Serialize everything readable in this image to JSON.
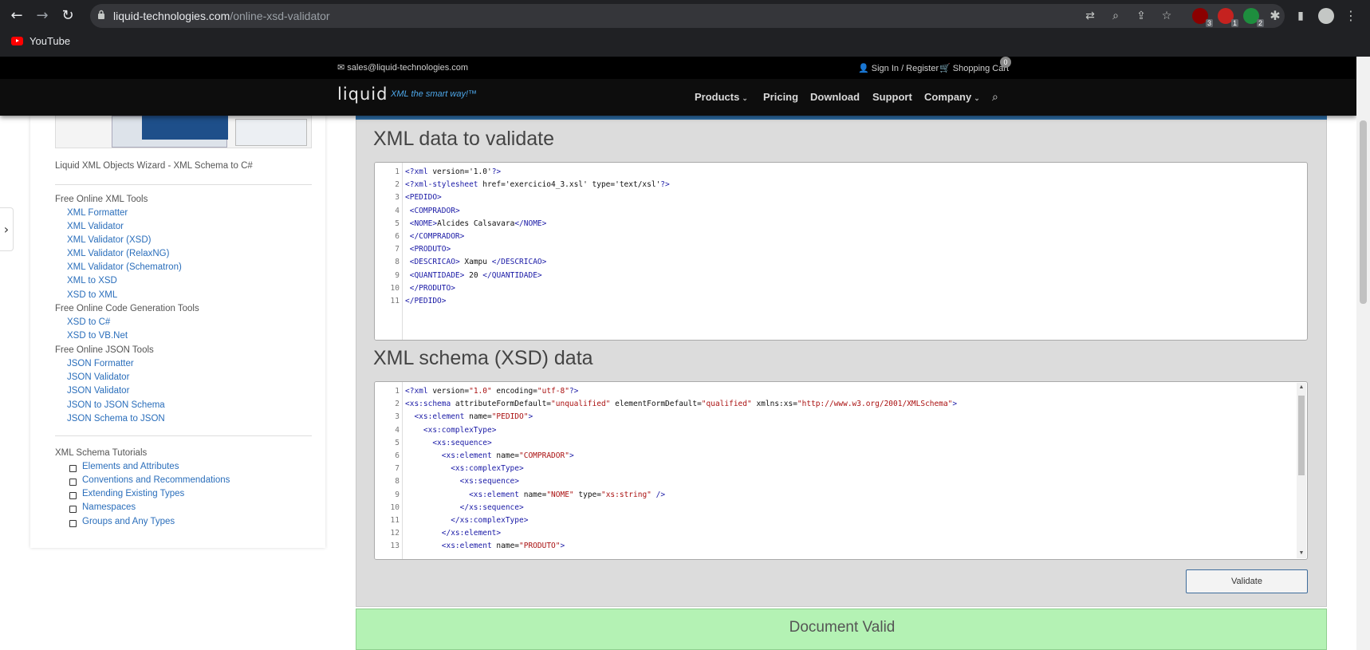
{
  "browser": {
    "url_host": "liquid-technologies.com",
    "url_path": "/online-xsd-validator",
    "bookmark": "YouTube",
    "ext_badges": [
      "3",
      "1",
      "2"
    ]
  },
  "site": {
    "email": "sales@liquid-technologies.com",
    "sign_in": "Sign In / Register",
    "cart": "Shopping Cart",
    "cart_count": "0",
    "logo": "liquid",
    "tagline": "XML the smart way!™",
    "menu": {
      "products": "Products",
      "pricing": "Pricing",
      "download": "Download",
      "support": "Support",
      "company": "Company"
    }
  },
  "sidebar": {
    "wizard": "Liquid XML Objects Wizard - XML Schema to C#",
    "sections": [
      {
        "heading": "Free Online XML Tools",
        "items": [
          "XML Formatter",
          "XML Validator",
          "XML Validator (XSD)",
          "XML Validator (RelaxNG)",
          "XML Validator (Schematron)",
          "XML to XSD",
          "XSD to XML"
        ]
      },
      {
        "heading": "Free Online Code Generation Tools",
        "items": [
          "XSD to C#",
          "XSD to VB.Net"
        ]
      },
      {
        "heading": "Free Online JSON Tools",
        "items": [
          "JSON Formatter",
          "JSON Validator",
          "JSON Validator",
          "JSON to JSON Schema",
          "JSON Schema to JSON"
        ]
      }
    ],
    "tutorials_heading": "XML Schema Tutorials",
    "tutorials": [
      "Elements and Attributes",
      "Conventions and Recommendations",
      "Extending Existing Types",
      "Namespaces",
      "Groups and Any Types"
    ]
  },
  "main": {
    "xml_title": "XML data to validate",
    "xsd_title": "XML schema (XSD) data",
    "validate_label": "Validate",
    "result": "Document Valid",
    "xml_lines": [
      "<?xml version='1.0'?>",
      "<?xml-stylesheet href='exercicio4_3.xsl' type='text/xsl'?>",
      "<PEDIDO>",
      " <COMPRADOR>",
      " <NOME>Alcides Calsavara</NOME>",
      " </COMPRADOR>",
      " <PRODUTO>",
      " <DESCRICAO> Xampu </DESCRICAO>",
      " <QUANTIDADE> 20 </QUANTIDADE>",
      " </PRODUTO>",
      "</PEDIDO>"
    ],
    "xsd_lines": [
      "<?xml version=\"1.0\" encoding=\"utf-8\"?>",
      "<xs:schema attributeFormDefault=\"unqualified\" elementFormDefault=\"qualified\" xmlns:xs=\"http://www.w3.org/2001/XMLSchema\">",
      "  <xs:element name=\"PEDIDO\">",
      "    <xs:complexType>",
      "      <xs:sequence>",
      "        <xs:element name=\"COMPRADOR\">",
      "          <xs:complexType>",
      "            <xs:sequence>",
      "              <xs:element name=\"NOME\" type=\"xs:string\" />",
      "            </xs:sequence>",
      "          </xs:complexType>",
      "        </xs:element>",
      "        <xs:element name=\"PRODUTO\">"
    ]
  },
  "colors": {
    "accent": "#2d6ea8",
    "valid": "#b4f2b4",
    "link": "#2a6ebb",
    "xml_tag": "#1a1aa6",
    "xml_attr_value": "#a11"
  }
}
